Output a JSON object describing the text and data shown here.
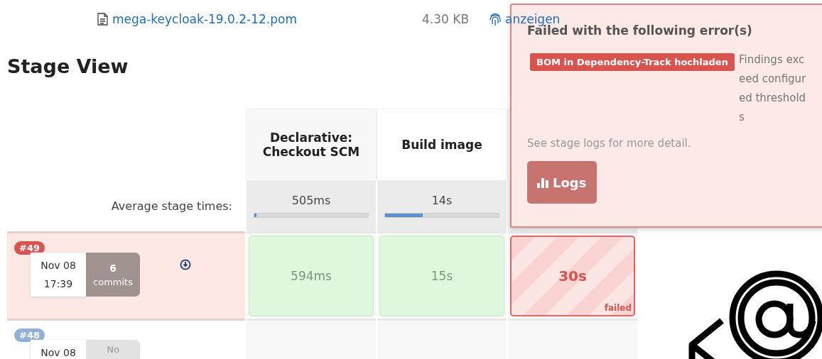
{
  "artifact": {
    "name": "mega-keycloak-19.0.2-12.pom",
    "size": "4.30 KB",
    "action": "anzeigen"
  },
  "title": "Stage View",
  "stages": [
    {
      "name": "Declarative: Checkout SCM"
    },
    {
      "name": "Build image"
    }
  ],
  "average_label": "Average stage times:",
  "average_times": [
    {
      "time": "505ms",
      "level": 0.02
    },
    {
      "time": "14s",
      "level": 0.33
    }
  ],
  "builds": [
    {
      "number": "#49",
      "failed": true,
      "date": "Nov 08",
      "time": "17:39",
      "commits_count": "6",
      "commits_label": "commits",
      "download": true,
      "cells": [
        {
          "time": "594ms",
          "failed": false
        },
        {
          "time": "15s",
          "failed": false
        },
        {
          "time": "30s",
          "failed": true,
          "label": "failed"
        }
      ]
    },
    {
      "number": "#48",
      "failed": false,
      "date": "Nov 08",
      "commits_label": "No",
      "download": false
    }
  ],
  "popover": {
    "title": "Failed with the following error(s)",
    "stage": "BOM in Dependency-Track hochladen",
    "message": "Findings exceed configured thresholds",
    "hint": "See stage logs for more detail.",
    "button": "Logs"
  }
}
